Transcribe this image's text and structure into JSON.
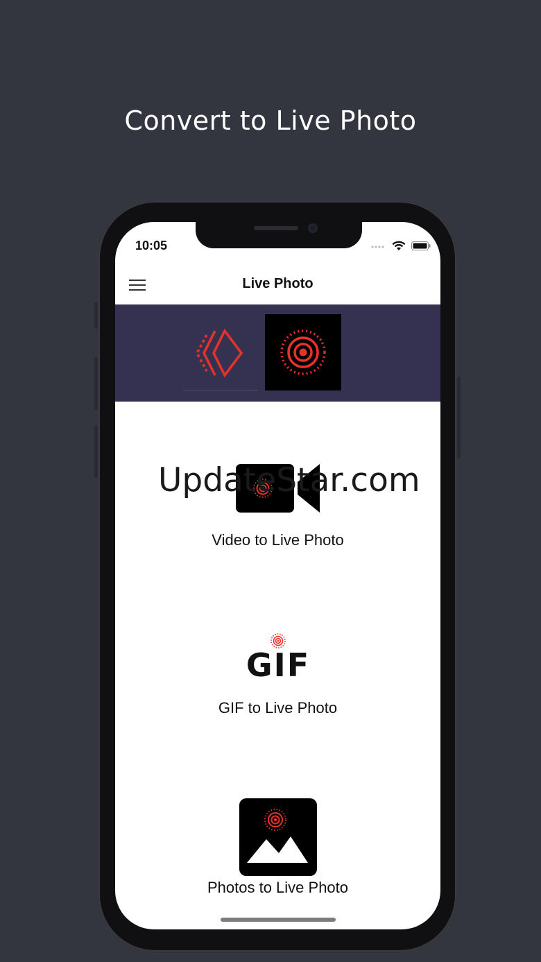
{
  "promo": {
    "headline": "Convert to Live Photo"
  },
  "status_bar": {
    "time": "10:05"
  },
  "navbar": {
    "title": "Live Photo"
  },
  "features": [
    {
      "label": "Video to Live Photo",
      "icon": "video-camera-icon"
    },
    {
      "label": "GIF to Live Photo",
      "icon": "gif-icon"
    },
    {
      "label": "Photos to Live Photo",
      "icon": "photo-icon"
    }
  ],
  "watermark": {
    "text": "UpdateStar.com"
  },
  "gif_icon_text": "GIF",
  "colors": {
    "background": "#34363f",
    "banner": "#343250",
    "accent": "#e8312b"
  }
}
